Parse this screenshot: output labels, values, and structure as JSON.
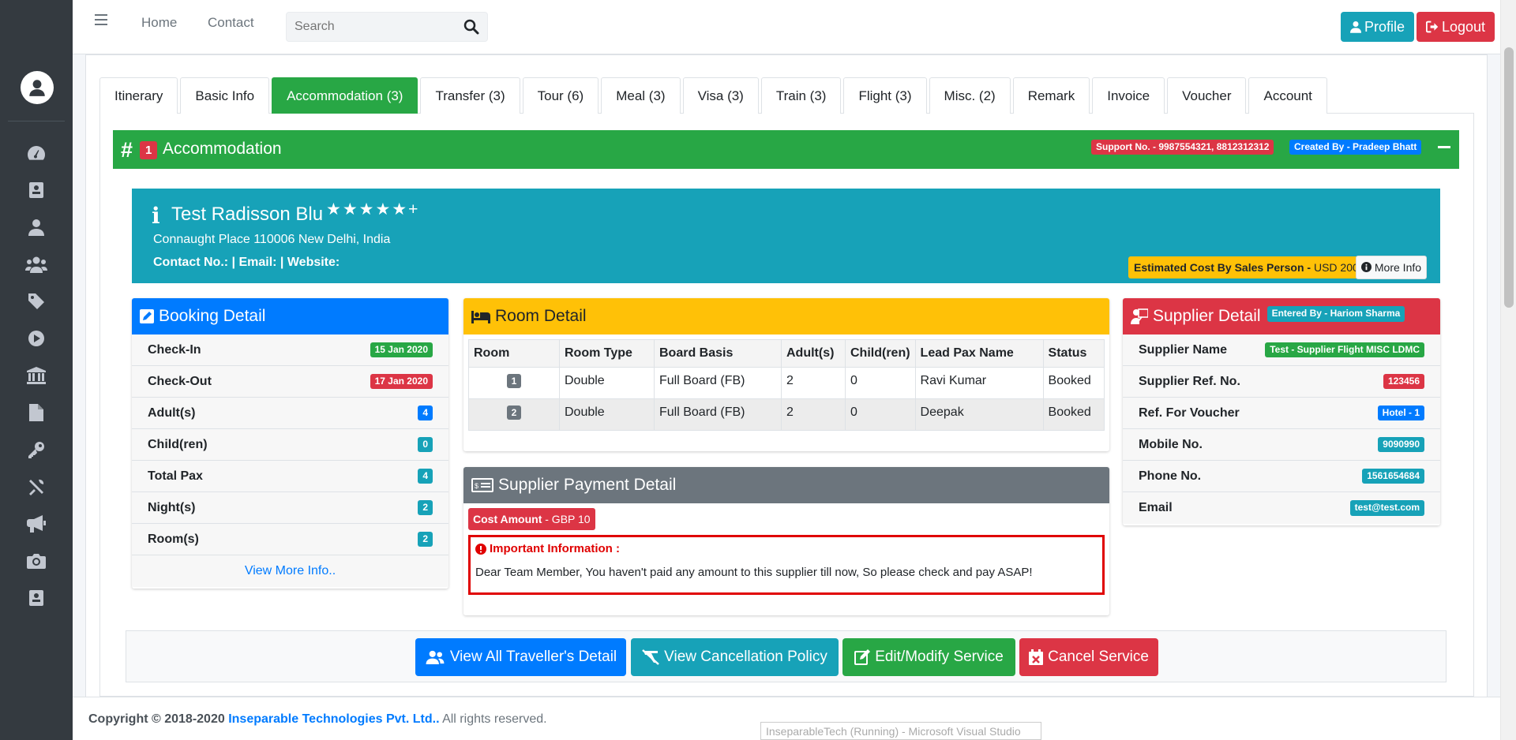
{
  "topbar": {
    "nav": [
      "Home",
      "Contact"
    ],
    "search_placeholder": "Search",
    "profile_label": "Profile",
    "logout_label": "Logout"
  },
  "sidebar": {
    "icons": [
      "dashboard-icon",
      "address-card-icon",
      "user-icon",
      "users-icon",
      "tag-icon",
      "play-circle-icon",
      "bank-icon",
      "file-icon",
      "key-icon",
      "tools-icon",
      "bullhorn-icon",
      "camera-icon",
      "contact-card-icon"
    ]
  },
  "tabs": [
    "Itinerary",
    "Basic Info",
    "Accommodation (3)",
    "Transfer (3)",
    "Tour (6)",
    "Meal (3)",
    "Visa (3)",
    "Train (3)",
    "Flight (3)",
    "Misc. (2)",
    "Remark",
    "Invoice",
    "Voucher",
    "Account"
  ],
  "active_tab": "Accommodation (3)",
  "accommodation": {
    "number": "1",
    "title": "Accommodation",
    "support": "Support No. - 9987554321, 8812312312",
    "created_by": "Created By - Pradeep Bhatt"
  },
  "hotel": {
    "name": "Test Radisson Blu",
    "stars": "★★★★★+",
    "address": "Connaught Place 110006 New Delhi, India",
    "contact": "Contact No.: | Email: | Website:",
    "est_label": "Estimated Cost By Sales Person -",
    "est_value": "USD 200",
    "more_info": "More Info"
  },
  "booking_detail": {
    "title": "Booking Detail",
    "rows": [
      {
        "label": "Check-In",
        "value": "15 Jan 2020",
        "color": "#28a745"
      },
      {
        "label": "Check-Out",
        "value": "17 Jan 2020",
        "color": "#dc3545"
      },
      {
        "label": "Adult(s)",
        "value": "4",
        "color": "#007bff"
      },
      {
        "label": "Child(ren)",
        "value": "0",
        "color": "#17a2b8"
      },
      {
        "label": "Total Pax",
        "value": "4",
        "color": "#17a2b8"
      },
      {
        "label": "Night(s)",
        "value": "2",
        "color": "#17a2b8"
      },
      {
        "label": "Room(s)",
        "value": "2",
        "color": "#17a2b8"
      }
    ],
    "view_more": "View More Info.."
  },
  "room_detail": {
    "title": "Room Detail",
    "headers": [
      "Room",
      "Room Type",
      "Board Basis",
      "Adult(s)",
      "Child(ren)",
      "Lead Pax Name",
      "Status"
    ],
    "rows": [
      [
        "1",
        "Double",
        "Full Board (FB)",
        "2",
        "0",
        "Ravi Kumar",
        "Booked"
      ],
      [
        "2",
        "Double",
        "Full Board (FB)",
        "2",
        "0",
        "Deepak",
        "Booked"
      ]
    ]
  },
  "supplier_payment": {
    "title": "Supplier Payment Detail",
    "cost_label": "Cost Amount",
    "cost_value": "- GBP 10",
    "important_title": "Important Information :",
    "important_text": "Dear Team Member, You haven't paid any amount to this supplier till now, So please check and pay ASAP!"
  },
  "supplier_detail": {
    "title": "Supplier Detail",
    "entered_by": "Entered By - Hariom Sharma",
    "rows": [
      {
        "label": "Supplier Name",
        "value": "Test - Supplier Flight MISC LDMC",
        "color": "#28a745"
      },
      {
        "label": "Supplier Ref. No.",
        "value": "123456",
        "color": "#dc3545"
      },
      {
        "label": "Ref. For Voucher",
        "value": "Hotel - 1",
        "color": "#007bff"
      },
      {
        "label": "Mobile No.",
        "value": "9090990",
        "color": "#17a2b8"
      },
      {
        "label": "Phone No.",
        "value": "1561654684",
        "color": "#17a2b8"
      },
      {
        "label": "Email",
        "value": "test@test.com",
        "color": "#17a2b8"
      }
    ]
  },
  "actions": {
    "view_travellers": "View All Traveller's Detail",
    "view_cancellation": "View Cancellation Policy",
    "edit_service": "Edit/Modify Service",
    "cancel_service": "Cancel Service"
  },
  "footer": {
    "prefix": "Copyright © 2018-2020",
    "company": "Inseparable Technologies Pvt. Ltd..",
    "suffix": "All rights reserved."
  },
  "taskbar_tip": "InseparableTech (Running) - Microsoft Visual Studio",
  "colors": {
    "green": "#28a745",
    "blue": "#007bff",
    "teal": "#17a2b8",
    "yellow": "#ffc107",
    "red": "#dc3545",
    "gray": "#6c757d",
    "sidebar": "#343a40"
  }
}
